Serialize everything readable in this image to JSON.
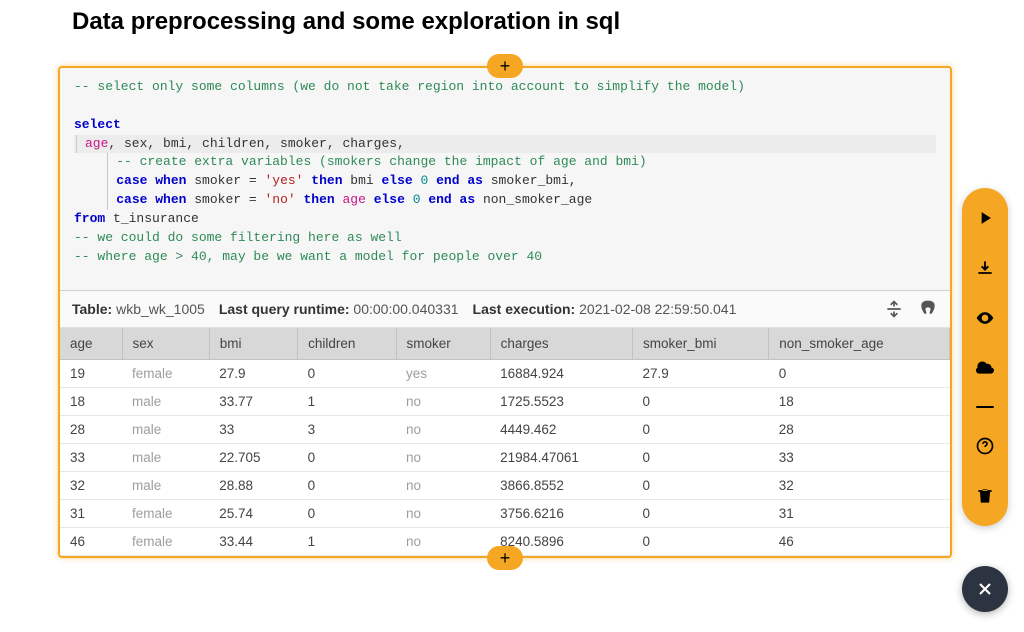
{
  "title": "Data preprocessing and some exploration in sql",
  "add_glyph": "+",
  "code": {
    "c1": "-- select only some columns (we do not take region into account to simplify the model)",
    "kw_select": "select",
    "cols_line": "age, sex, bmi, children, smoker, charges,",
    "col_age": "age",
    "cols_rest": ", sex, bmi, children, smoker, charges,",
    "c2": "-- create extra variables (smokers change the impact of age and bmi)",
    "kw_case1a": "case when",
    "id_smoker": "smoker",
    "eq": " = ",
    "str_yes": "'yes'",
    "kw_then": " then ",
    "id_bmi": "bmi",
    "kw_else": " else ",
    "num_zero": "0",
    "kw_end_as": " end as ",
    "id_smoker_bmi": "smoker_bmi,",
    "str_no": "'no'",
    "col_age2": "age",
    "id_non_smoker_age": "non_smoker_age",
    "kw_from": "from",
    "id_table": " t_insurance",
    "c3": "-- we could do some filtering here as well",
    "c4": "-- where age > 40, may be we want a model for people over 40"
  },
  "meta": {
    "table_label": "Table:",
    "table_name": "wkb_wk_1005",
    "runtime_label": "Last query runtime:",
    "runtime_value": "00:00:00.040331",
    "exec_label": "Last execution:",
    "exec_value": "2021-02-08 22:59:50.041"
  },
  "columns": [
    "age",
    "sex",
    "bmi",
    "children",
    "smoker",
    "charges",
    "smoker_bmi",
    "non_smoker_age"
  ],
  "rows": [
    {
      "age": "19",
      "sex": "female",
      "bmi": "27.9",
      "children": "0",
      "smoker": "yes",
      "charges": "16884.924",
      "smoker_bmi": "27.9",
      "non_smoker_age": "0"
    },
    {
      "age": "18",
      "sex": "male",
      "bmi": "33.77",
      "children": "1",
      "smoker": "no",
      "charges": "1725.5523",
      "smoker_bmi": "0",
      "non_smoker_age": "18"
    },
    {
      "age": "28",
      "sex": "male",
      "bmi": "33",
      "children": "3",
      "smoker": "no",
      "charges": "4449.462",
      "smoker_bmi": "0",
      "non_smoker_age": "28"
    },
    {
      "age": "33",
      "sex": "male",
      "bmi": "22.705",
      "children": "0",
      "smoker": "no",
      "charges": "21984.47061",
      "smoker_bmi": "0",
      "non_smoker_age": "33"
    },
    {
      "age": "32",
      "sex": "male",
      "bmi": "28.88",
      "children": "0",
      "smoker": "no",
      "charges": "3866.8552",
      "smoker_bmi": "0",
      "non_smoker_age": "32"
    },
    {
      "age": "31",
      "sex": "female",
      "bmi": "25.74",
      "children": "0",
      "smoker": "no",
      "charges": "3756.6216",
      "smoker_bmi": "0",
      "non_smoker_age": "31"
    },
    {
      "age": "46",
      "sex": "female",
      "bmi": "33.44",
      "children": "1",
      "smoker": "no",
      "charges": "8240.5896",
      "smoker_bmi": "0",
      "non_smoker_age": "46"
    }
  ]
}
